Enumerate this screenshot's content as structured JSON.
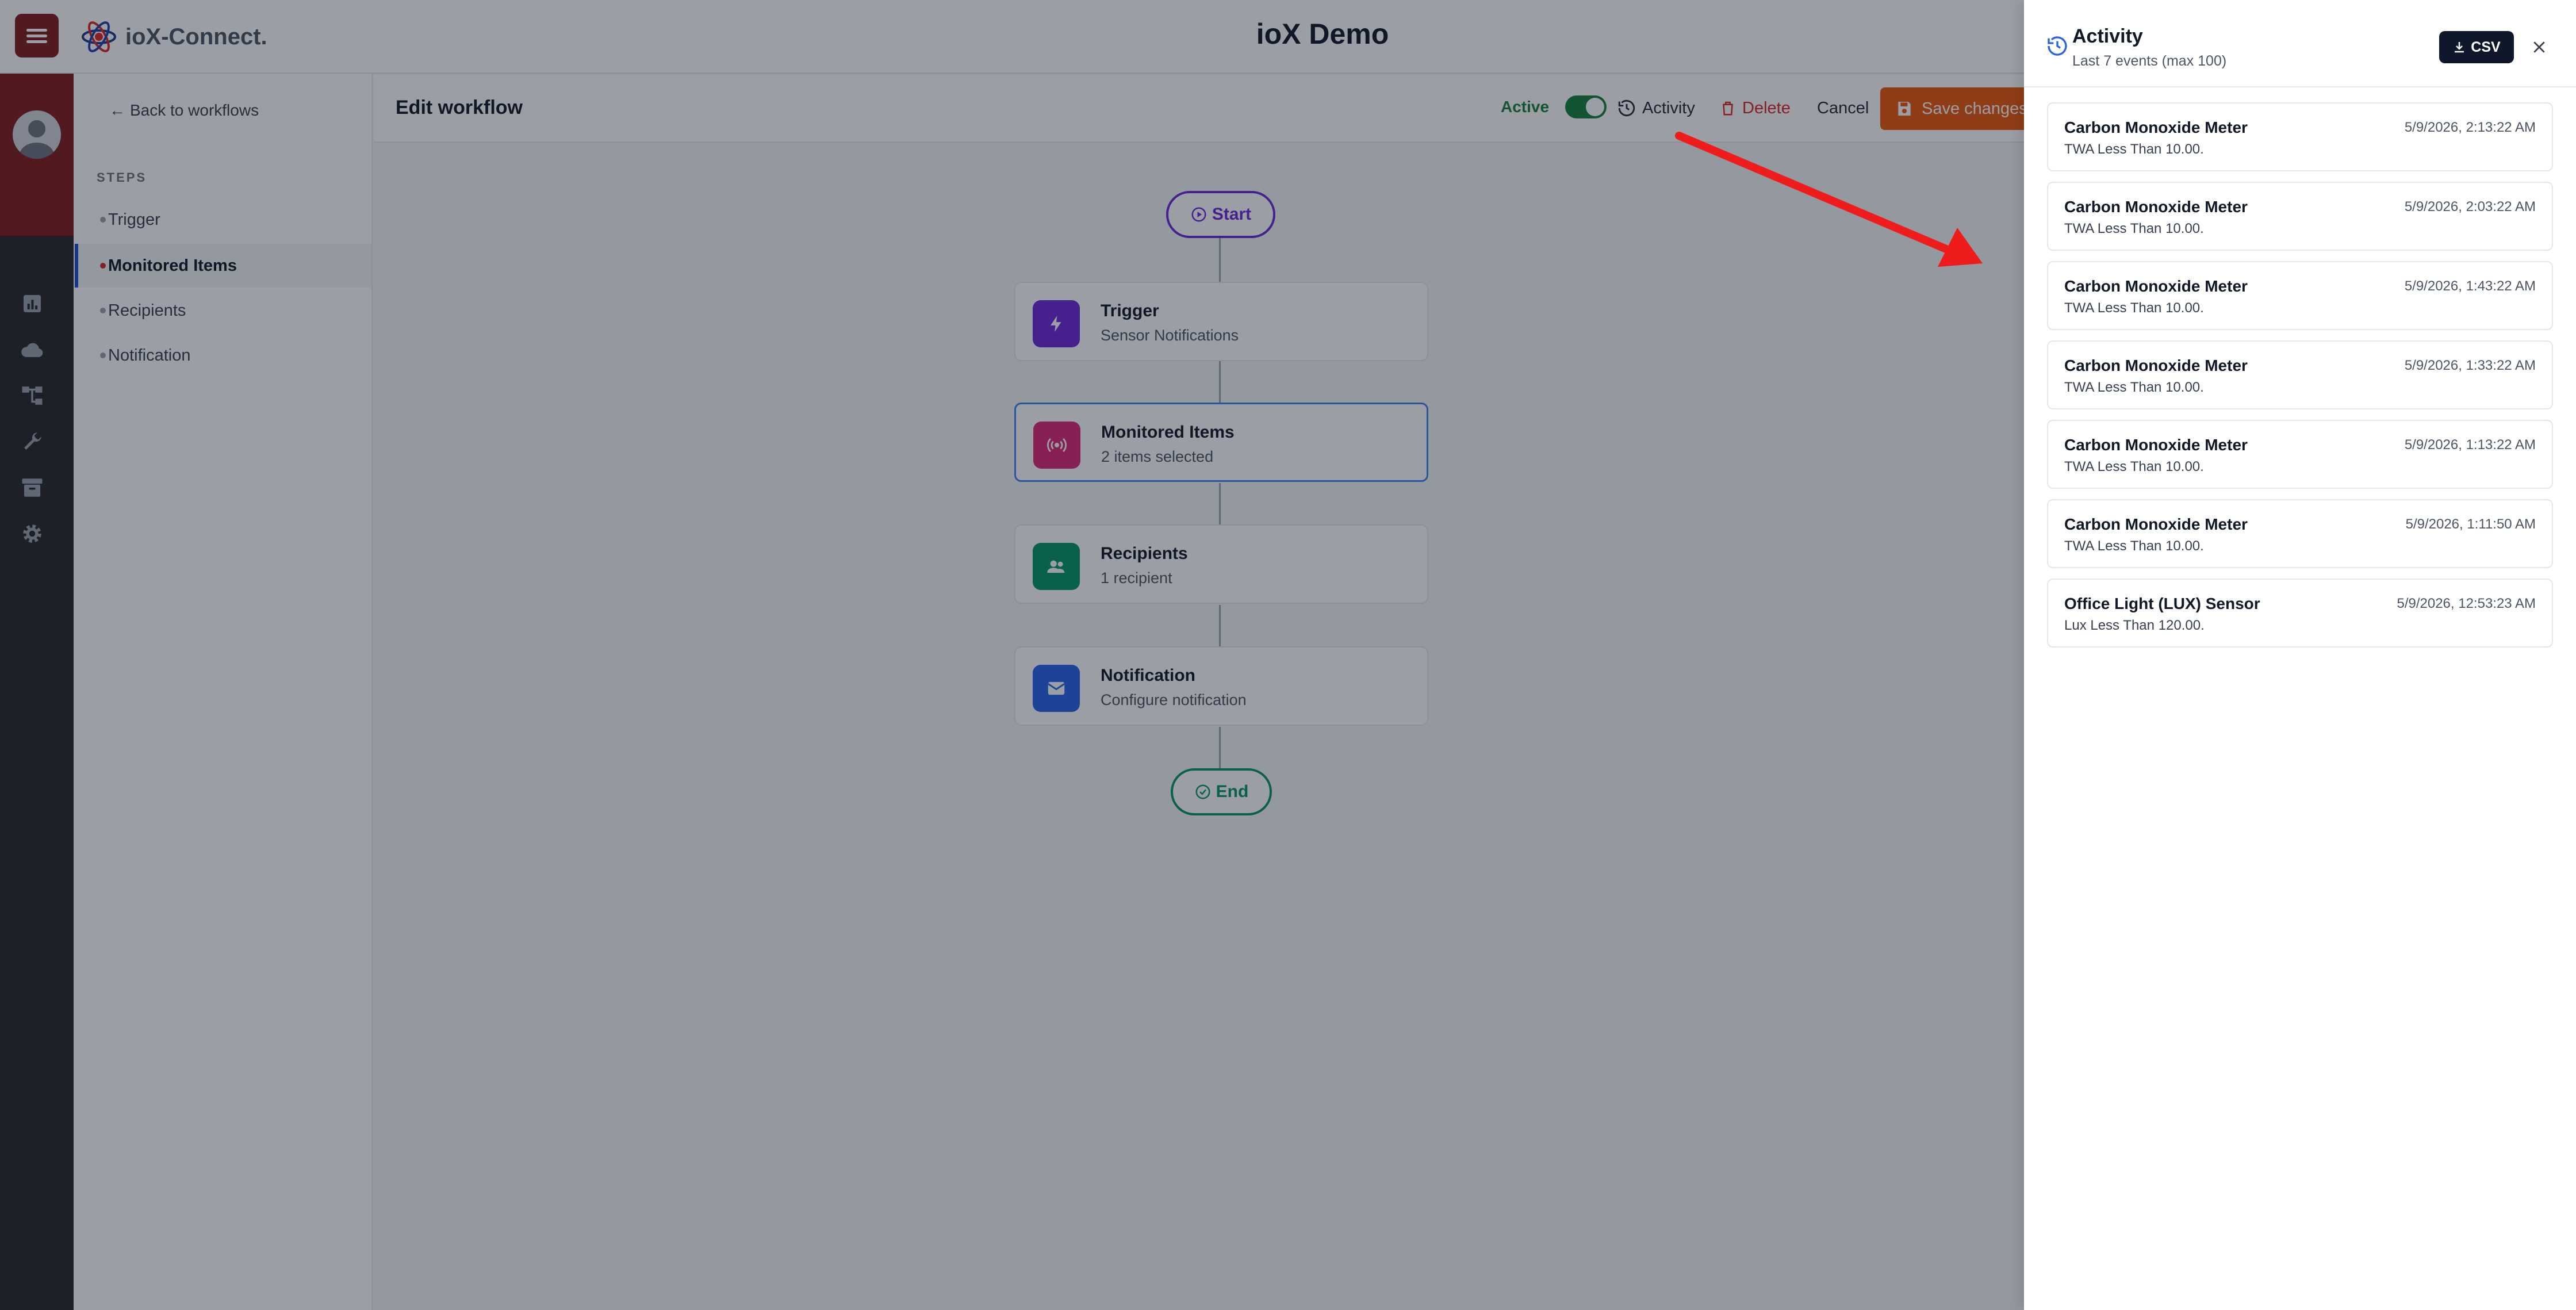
{
  "header": {
    "app_title": "ioX Demo",
    "logo_text": "ioX-Connect."
  },
  "steps_sidebar": {
    "back_link": "Back to workflows",
    "section_label": "STEPS",
    "items": [
      {
        "label": "Trigger"
      },
      {
        "label": "Monitored Items"
      },
      {
        "label": "Recipients"
      },
      {
        "label": "Notification"
      }
    ]
  },
  "toolbar": {
    "title": "Edit workflow",
    "active_label": "Active",
    "activity_label": "Activity",
    "delete_label": "Delete",
    "cancel_label": "Cancel",
    "save_label": "Save changes"
  },
  "flow": {
    "start_label": "Start",
    "end_label": "End",
    "nodes": [
      {
        "title": "Trigger",
        "subtitle": "Sensor Notifications"
      },
      {
        "title": "Monitored Items",
        "subtitle": "2 items selected"
      },
      {
        "title": "Recipients",
        "subtitle": "1 recipient"
      },
      {
        "title": "Notification",
        "subtitle": "Configure notification"
      }
    ]
  },
  "activity": {
    "title": "Activity",
    "subtitle": "Last 7 events (max 100)",
    "csv_label": "CSV",
    "events": [
      {
        "name": "Carbon Monoxide Meter",
        "desc": "TWA Less Than 10.00.",
        "time": "5/9/2026, 2:13:22 AM"
      },
      {
        "name": "Carbon Monoxide Meter",
        "desc": "TWA Less Than 10.00.",
        "time": "5/9/2026, 2:03:22 AM"
      },
      {
        "name": "Carbon Monoxide Meter",
        "desc": "TWA Less Than 10.00.",
        "time": "5/9/2026, 1:43:22 AM"
      },
      {
        "name": "Carbon Monoxide Meter",
        "desc": "TWA Less Than 10.00.",
        "time": "5/9/2026, 1:33:22 AM"
      },
      {
        "name": "Carbon Monoxide Meter",
        "desc": "TWA Less Than 10.00.",
        "time": "5/9/2026, 1:13:22 AM"
      },
      {
        "name": "Carbon Monoxide Meter",
        "desc": "TWA Less Than 10.00.",
        "time": "5/9/2026, 1:11:50 AM"
      },
      {
        "name": "Office Light (LUX) Sensor",
        "desc": "Lux Less Than 120.00.",
        "time": "5/9/2026, 12:53:23 AM"
      }
    ]
  },
  "colors": {
    "brand": "#7f1d1d",
    "accent": "#ea580c",
    "active": "#15803d",
    "danger": "#dc2626",
    "annotation": "#ef1c1c"
  },
  "rail_icons": [
    "chart-icon",
    "cloud-icon",
    "hierarchy-icon",
    "wrench-icon",
    "archive-icon",
    "gear-icon"
  ]
}
